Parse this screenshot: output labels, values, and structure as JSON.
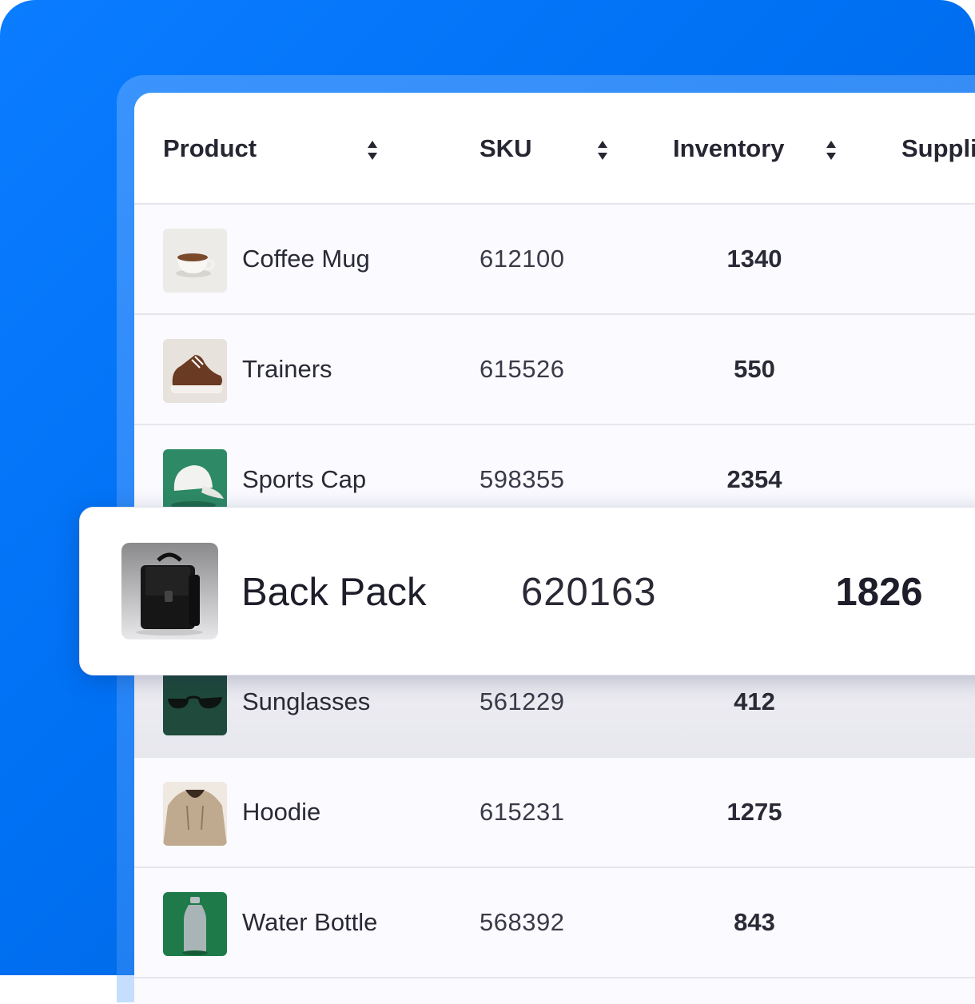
{
  "table": {
    "columns": [
      {
        "label": "Product",
        "sortable": true
      },
      {
        "label": "SKU",
        "sortable": true
      },
      {
        "label": "Inventory",
        "sortable": true
      },
      {
        "label": "Suppli",
        "sortable": false
      }
    ],
    "rows": [
      {
        "name": "Coffee Mug",
        "sku": "612100",
        "inventory": "1340",
        "thumb_icon": "coffee-mug"
      },
      {
        "name": "Trainers",
        "sku": "615526",
        "inventory": "550",
        "thumb_icon": "trainers"
      },
      {
        "name": "Sports Cap",
        "sku": "598355",
        "inventory": "2354",
        "thumb_icon": "sports-cap"
      },
      {
        "name": "Sunglasses",
        "sku": "561229",
        "inventory": "412",
        "thumb_icon": "sunglasses"
      },
      {
        "name": "Hoodie",
        "sku": "615231",
        "inventory": "1275",
        "thumb_icon": "hoodie"
      },
      {
        "name": "Water Bottle",
        "sku": "568392",
        "inventory": "843",
        "thumb_icon": "water-bottle"
      }
    ],
    "highlighted": {
      "name": "Back Pack",
      "sku": "620163",
      "inventory": "1826",
      "thumb_icon": "back-pack"
    }
  },
  "colors": {
    "accent": "#0a7cff",
    "table_bg": "#fafaff",
    "text": "#262633"
  }
}
